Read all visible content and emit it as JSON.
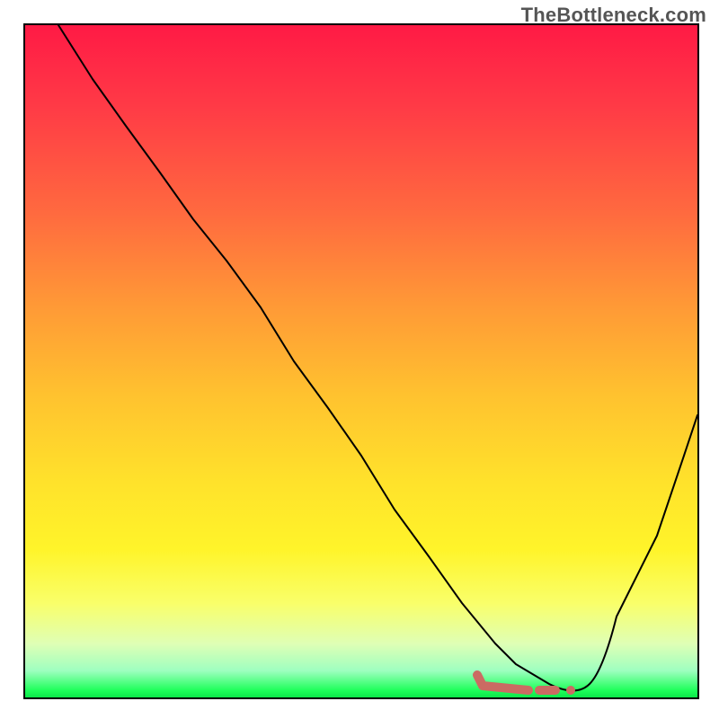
{
  "watermark": "TheBottleneck.com",
  "chart_data": {
    "type": "line",
    "title": "",
    "xlabel": "",
    "ylabel": "",
    "xlim": [
      0,
      100
    ],
    "ylim": [
      0,
      100
    ],
    "grid": false,
    "legend": false,
    "background_gradient": {
      "top": "#ff1a45",
      "mid": "#ffe22b",
      "bottom": "#0be64a"
    },
    "series": [
      {
        "name": "bottleneck-curve",
        "x": [
          5,
          10,
          15,
          20,
          25,
          30,
          35,
          40,
          45,
          50,
          55,
          60,
          65,
          70,
          73,
          78,
          82,
          86,
          90,
          94,
          98,
          100
        ],
        "y": [
          100,
          92,
          85,
          78,
          72,
          65,
          58,
          50,
          43,
          36,
          28,
          21,
          14,
          8,
          5,
          2,
          0,
          2,
          12,
          24,
          36,
          42
        ]
      }
    ],
    "annotations": [
      {
        "name": "optimal-zone",
        "shape": "pill",
        "x_start": 67,
        "x_end": 83,
        "y": 2,
        "color": "#cb6b63"
      }
    ]
  }
}
